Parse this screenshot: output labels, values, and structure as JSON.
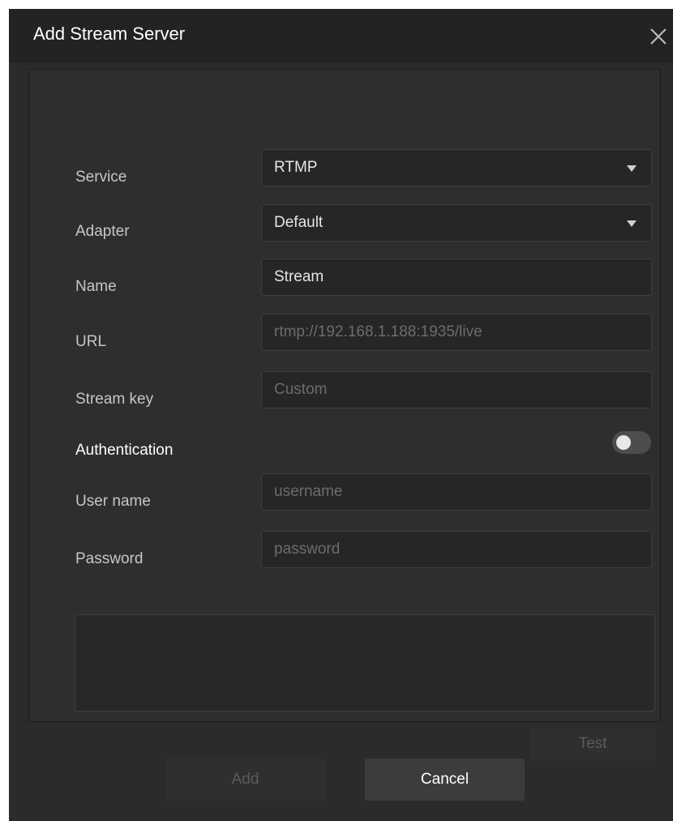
{
  "dialog": {
    "title": "Add Stream Server",
    "close_icon": "close-icon"
  },
  "form": {
    "service": {
      "label": "Service",
      "value": "RTMP"
    },
    "adapter": {
      "label": "Adapter",
      "value": "Default"
    },
    "name": {
      "label": "Name",
      "value": "Stream"
    },
    "url": {
      "label": "URL",
      "placeholder": "rtmp://192.168.1.188:1935/live"
    },
    "stream_key": {
      "label": "Stream key",
      "placeholder": "Custom"
    },
    "authentication": {
      "label": "Authentication",
      "enabled": false
    },
    "username": {
      "label": "User name",
      "placeholder": "username"
    },
    "password": {
      "label": "Password",
      "placeholder": "password"
    }
  },
  "buttons": {
    "test": "Test",
    "add": "Add",
    "cancel": "Cancel"
  },
  "colors": {
    "background": "#2b2b2b",
    "titlebar": "#232323",
    "field_bg": "#262626"
  }
}
